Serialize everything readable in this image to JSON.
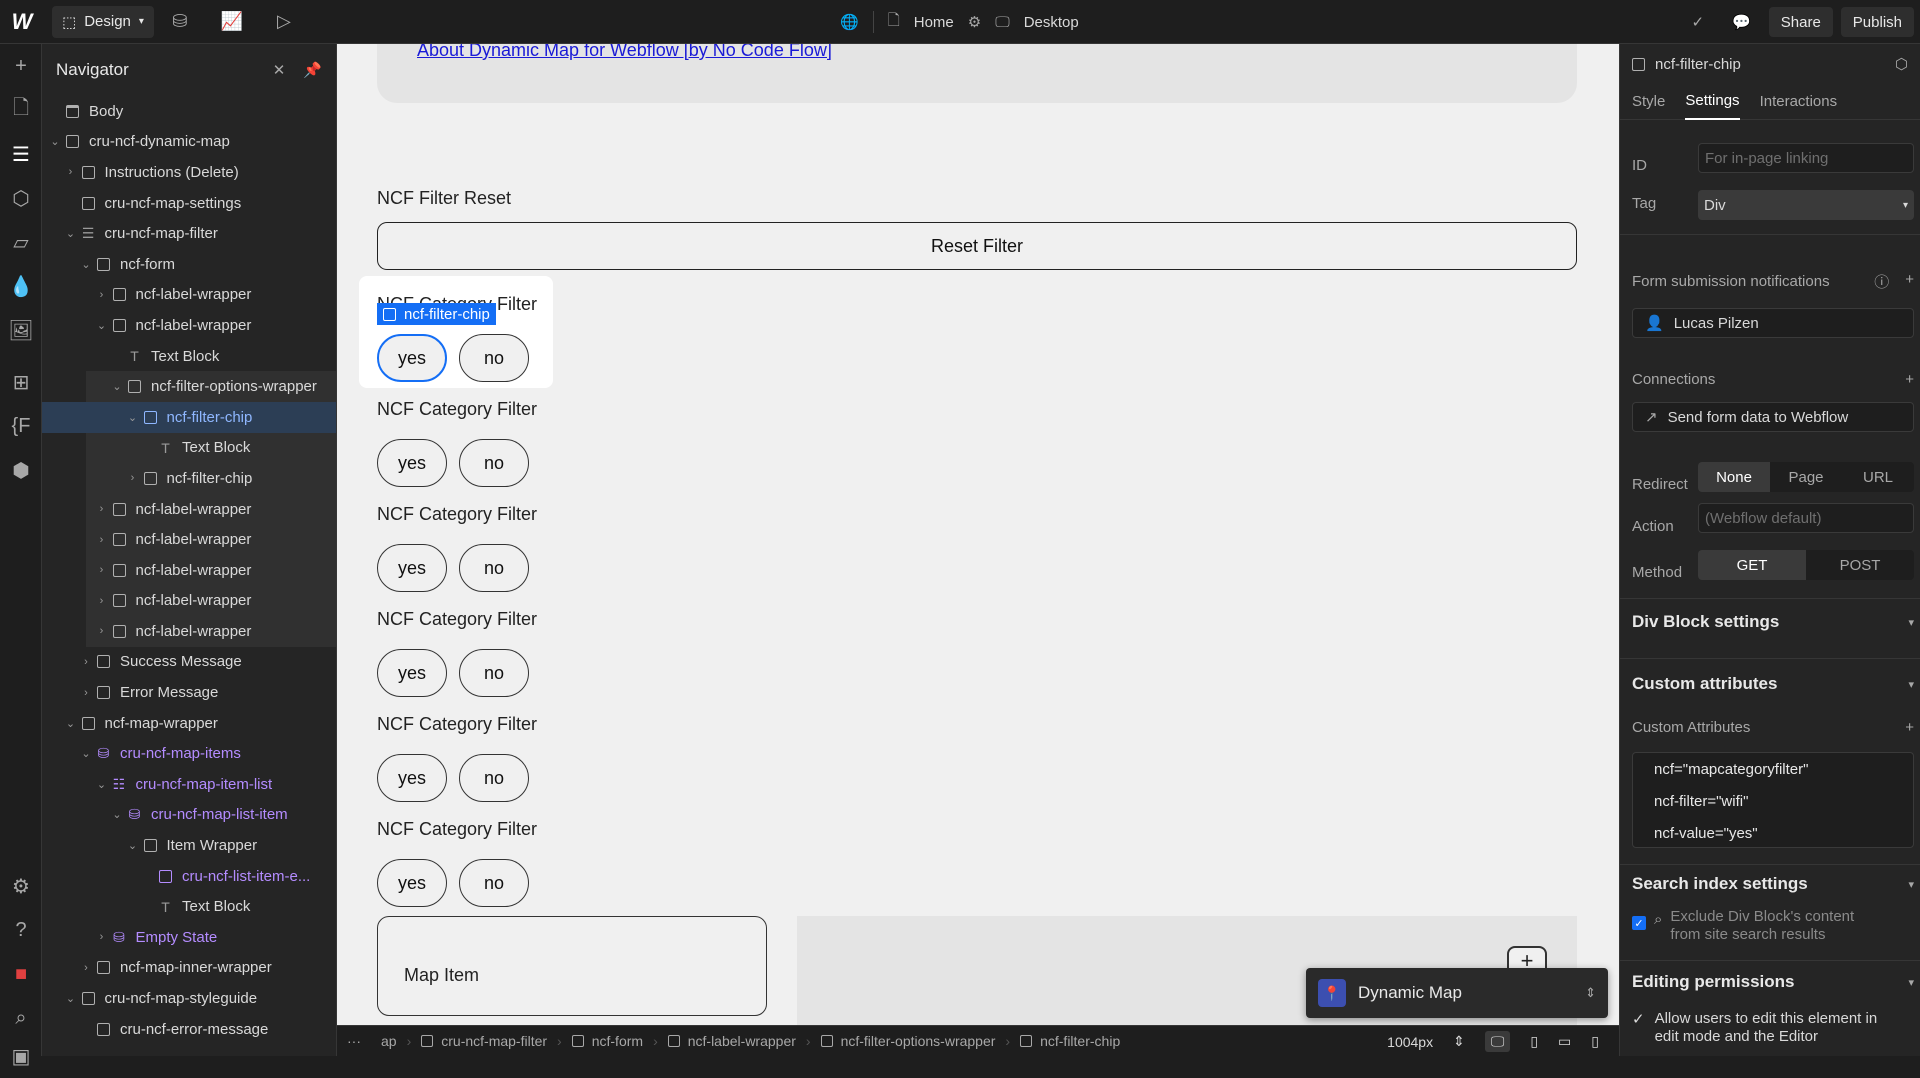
{
  "topbar": {
    "mode": "Design",
    "page": "Home",
    "breakpoint": "Desktop",
    "share": "Share",
    "publish": "Publish"
  },
  "navigator": {
    "title": "Navigator",
    "tree": [
      {
        "label": "Body",
        "indent": 0,
        "chev": "",
        "icon": "body"
      },
      {
        "label": "cru-ncf-dynamic-map",
        "indent": 0,
        "chev": "v",
        "icon": "box"
      },
      {
        "label": "Instructions (Delete)",
        "indent": 1,
        "chev": ">",
        "icon": "box"
      },
      {
        "label": "cru-ncf-map-settings",
        "indent": 1,
        "chev": "",
        "icon": "code"
      },
      {
        "label": "cru-ncf-map-filter",
        "indent": 1,
        "chev": "v",
        "icon": "form"
      },
      {
        "label": "ncf-form",
        "indent": 2,
        "chev": "v",
        "icon": "box"
      },
      {
        "label": "ncf-label-wrapper",
        "indent": 3,
        "chev": ">",
        "icon": "box"
      },
      {
        "label": "ncf-label-wrapper",
        "indent": 3,
        "chev": "v",
        "icon": "box"
      },
      {
        "label": "Text Block",
        "indent": 4,
        "chev": "",
        "icon": "text"
      },
      {
        "label": "ncf-filter-options-wrapper",
        "indent": 4,
        "chev": "v",
        "icon": "box",
        "grp": true
      },
      {
        "label": "ncf-filter-chip",
        "indent": 5,
        "chev": "v",
        "icon": "box",
        "sel": true
      },
      {
        "label": "Text Block",
        "indent": 6,
        "chev": "",
        "icon": "text",
        "grp": true
      },
      {
        "label": "ncf-filter-chip",
        "indent": 5,
        "chev": ">",
        "icon": "box",
        "grp": true
      },
      {
        "label": "ncf-label-wrapper",
        "indent": 3,
        "chev": ">",
        "icon": "box",
        "grp": true
      },
      {
        "label": "ncf-label-wrapper",
        "indent": 3,
        "chev": ">",
        "icon": "box",
        "grp": true
      },
      {
        "label": "ncf-label-wrapper",
        "indent": 3,
        "chev": ">",
        "icon": "box",
        "grp": true
      },
      {
        "label": "ncf-label-wrapper",
        "indent": 3,
        "chev": ">",
        "icon": "box",
        "grp": true
      },
      {
        "label": "ncf-label-wrapper",
        "indent": 3,
        "chev": ">",
        "icon": "box",
        "grp": true
      },
      {
        "label": "Success Message",
        "indent": 2,
        "chev": ">",
        "icon": "box"
      },
      {
        "label": "Error Message",
        "indent": 2,
        "chev": ">",
        "icon": "box"
      },
      {
        "label": "ncf-map-wrapper",
        "indent": 1,
        "chev": "v",
        "icon": "box"
      },
      {
        "label": "cru-ncf-map-items",
        "indent": 2,
        "chev": "v",
        "icon": "db",
        "purple": true
      },
      {
        "label": "cru-ncf-map-item-list",
        "indent": 3,
        "chev": "v",
        "icon": "list",
        "purple": true
      },
      {
        "label": "cru-ncf-map-list-item",
        "indent": 4,
        "chev": "v",
        "icon": "db",
        "purple": true
      },
      {
        "label": "Item Wrapper",
        "indent": 5,
        "chev": "v",
        "icon": "box"
      },
      {
        "label": "cru-ncf-list-item-e...",
        "indent": 6,
        "chev": "",
        "icon": "code",
        "purple": true
      },
      {
        "label": "Text Block",
        "indent": 6,
        "chev": "",
        "icon": "text"
      },
      {
        "label": "Empty State",
        "indent": 3,
        "chev": ">",
        "icon": "db",
        "purple": true
      },
      {
        "label": "ncf-map-inner-wrapper",
        "indent": 2,
        "chev": ">",
        "icon": "box"
      },
      {
        "label": "cru-ncf-map-styleguide",
        "indent": 1,
        "chev": "v",
        "icon": "box"
      },
      {
        "label": "cru-ncf-error-message",
        "indent": 2,
        "chev": "",
        "icon": "code"
      }
    ]
  },
  "canvas": {
    "top_link": "About Dynamic Map for Webflow [by No Code Flow]",
    "reset_heading": "NCF Filter Reset",
    "reset_button": "Reset Filter",
    "filter_heading": "NCF Category Filter",
    "chip_yes": "yes",
    "chip_no": "no",
    "selected_tag": "ncf-filter-chip",
    "map_item": "Map Item",
    "dynamic_map": "Dynamic Map"
  },
  "breadcrumbs": [
    "ap",
    "cru-ncf-map-filter",
    "ncf-form",
    "ncf-label-wrapper",
    "ncf-filter-options-wrapper",
    "ncf-filter-chip"
  ],
  "width_readout": "1004px",
  "settings": {
    "element": "ncf-filter-chip",
    "tabs": [
      "Style",
      "Settings",
      "Interactions"
    ],
    "id_label": "ID",
    "id_placeholder": "For in-page linking",
    "tag_label": "Tag",
    "tag_value": "Div",
    "notif_label": "Form submission notifications",
    "notif_user": "Lucas Pilzen",
    "connections_label": "Connections",
    "connection_item": "Send form data to Webflow",
    "redirect_label": "Redirect",
    "redirect_opts": [
      "None",
      "Page",
      "URL"
    ],
    "action_label": "Action",
    "action_placeholder": "(Webflow default)",
    "method_label": "Method",
    "method_opts": [
      "GET",
      "POST"
    ],
    "div_settings": "Div Block settings",
    "custom_attrs_heading": "Custom attributes",
    "custom_attrs_label": "Custom Attributes",
    "attrs": [
      "ncf=\"mapcategoryfilter\"",
      "ncf-filter=\"wifi\"",
      "ncf-value=\"yes\""
    ],
    "search_heading": "Search index settings",
    "search_text": "Exclude Div Block's content from site search results",
    "perm_heading": "Editing permissions",
    "perm_text": "Allow users to edit this element in edit mode and the Editor"
  }
}
